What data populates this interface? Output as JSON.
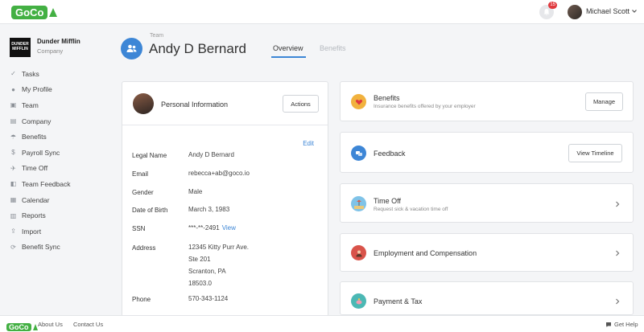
{
  "topbar": {
    "logo_text": "GoCo",
    "notification_count": "15",
    "user_name": "Michael Scott"
  },
  "sidebar": {
    "company_logo_text": "DUNDER MIFFLIN",
    "company_name": "Dunder Mifflin",
    "company_label": "Company",
    "items": [
      {
        "label": "Tasks",
        "icon": "check-icon"
      },
      {
        "label": "My Profile",
        "icon": "user-circle-icon"
      },
      {
        "label": "Team",
        "icon": "team-icon"
      },
      {
        "label": "Company",
        "icon": "building-icon"
      },
      {
        "label": "Benefits",
        "icon": "umbrella-icon"
      },
      {
        "label": "Payroll Sync",
        "icon": "money-icon"
      },
      {
        "label": "Time Off",
        "icon": "plane-icon"
      },
      {
        "label": "Team Feedback",
        "icon": "chat-icon"
      },
      {
        "label": "Calendar",
        "icon": "calendar-icon"
      },
      {
        "label": "Reports",
        "icon": "bar-chart-icon"
      },
      {
        "label": "Import",
        "icon": "upload-icon"
      },
      {
        "label": "Benefit Sync",
        "icon": "sync-icon"
      }
    ]
  },
  "header": {
    "breadcrumb": "Team",
    "title": "Andy D Bernard",
    "tabs": [
      "Overview",
      "Benefits"
    ],
    "active_tab": "Overview"
  },
  "personal_info": {
    "title": "Personal Information",
    "actions_label": "Actions",
    "edit_label": "Edit",
    "fields": {
      "legal_name": {
        "label": "Legal Name",
        "value": "Andy D Bernard"
      },
      "email": {
        "label": "Email",
        "value": "rebecca+ab@goco.io"
      },
      "gender": {
        "label": "Gender",
        "value": "Male"
      },
      "dob": {
        "label": "Date of Birth",
        "value": "March 3, 1983"
      },
      "ssn": {
        "label": "SSN",
        "value": "***-**-2491",
        "link": "View"
      },
      "address": {
        "label": "Address",
        "lines": [
          "12345 Kitty Purr Ave.",
          "Ste 201",
          "Scranton, PA",
          "18503.0"
        ]
      },
      "phone": {
        "label": "Phone",
        "value": "570-343-1124"
      }
    }
  },
  "cards": {
    "benefits": {
      "title": "Benefits",
      "subtitle": "Insurance benefits offered by your employer",
      "button": "Manage"
    },
    "feedback": {
      "title": "Feedback",
      "button": "View Timeline"
    },
    "time_off": {
      "title": "Time Off",
      "subtitle": "Request sick & vacation time off"
    },
    "employment": {
      "title": "Employment and Compensation"
    },
    "payment": {
      "title": "Payment & Tax"
    }
  },
  "footer": {
    "logo_text": "GoCo",
    "about": "About Us",
    "contact": "Contact Us",
    "help": "Get Help"
  },
  "colors": {
    "brand_green": "#43b043",
    "link_blue": "#3d86d6",
    "badge_red": "#e0393e"
  }
}
